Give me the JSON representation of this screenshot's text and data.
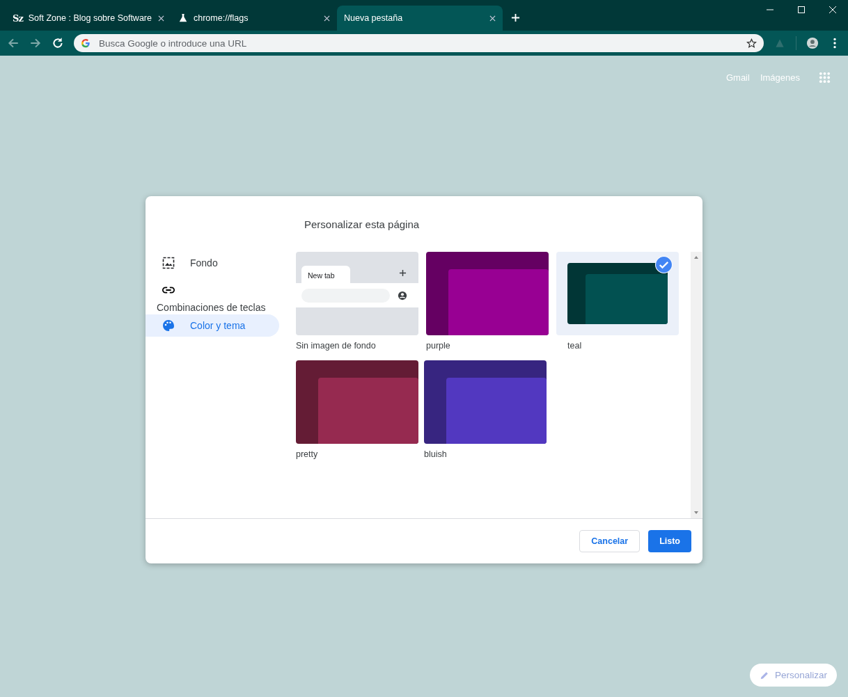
{
  "tabs": [
    {
      "title": "Soft Zone : Blog sobre Software",
      "kind": "logo",
      "icon_text": "Sz",
      "selected": false
    },
    {
      "title": "chrome://flags",
      "kind": "flask",
      "selected": false
    },
    {
      "title": "Nueva pestaña",
      "kind": "plain",
      "selected": true
    }
  ],
  "omnibox": {
    "placeholder": "Busca Google o introduce una URL"
  },
  "top_links": [
    "Gmail",
    "Imágenes"
  ],
  "dialog": {
    "title": "Personalizar esta página",
    "menu": [
      {
        "label": "Fondo",
        "kind": "image",
        "selected": false
      },
      {
        "label": "Combinaciones de teclas",
        "kind": "link",
        "selected": false
      },
      {
        "label": "Color y tema",
        "kind": "palette",
        "selected": true
      }
    ],
    "themes": [
      {
        "label": "Sin imagen de fondo",
        "kind": "default",
        "selected": false,
        "preview_tab": "New tab"
      },
      {
        "label": "purple",
        "kind": "color",
        "color": "#650062",
        "selected": false
      },
      {
        "label": "teal",
        "kind": "color",
        "color": "#013636",
        "selected": true
      },
      {
        "label": "pretty",
        "kind": "color",
        "color": "#641c35",
        "selected": false
      },
      {
        "label": "bluish",
        "kind": "color",
        "color": "#372580",
        "selected": false
      }
    ],
    "buttons": [
      {
        "label": "Cancelar",
        "kind": "secondary"
      },
      {
        "label": "Listo",
        "kind": "primary"
      }
    ]
  },
  "customize_button": "Personalizar"
}
